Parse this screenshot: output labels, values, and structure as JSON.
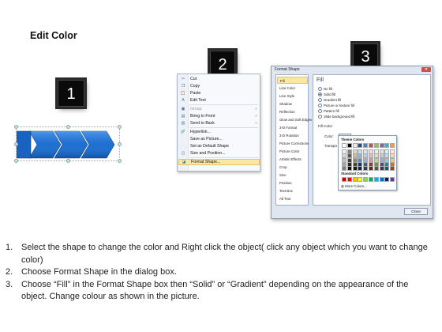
{
  "title": "Edit Color",
  "badges": [
    "1",
    "2",
    "3"
  ],
  "context_menu": {
    "items": [
      {
        "icon": "scissors-icon",
        "glyph": "✂",
        "label": "Cut",
        "disabled": false,
        "submenu": false,
        "highlighted": false
      },
      {
        "icon": "copy-icon",
        "glyph": "❐",
        "label": "Copy",
        "disabled": false,
        "submenu": false,
        "highlighted": false
      },
      {
        "icon": "paste-icon",
        "glyph": "📋",
        "label": "Paste",
        "disabled": false,
        "submenu": false,
        "highlighted": false
      },
      {
        "icon": "edit-text-icon",
        "glyph": "A",
        "label": "Edit Text",
        "disabled": false,
        "submenu": false,
        "highlighted": false
      },
      {
        "icon": "group-icon",
        "glyph": "▣",
        "label": "Group",
        "disabled": true,
        "submenu": true,
        "highlighted": false
      },
      {
        "icon": "bring-front-icon",
        "glyph": "▤",
        "label": "Bring to Front",
        "disabled": false,
        "submenu": true,
        "highlighted": false
      },
      {
        "icon": "send-back-icon",
        "glyph": "▥",
        "label": "Send to Back",
        "disabled": false,
        "submenu": true,
        "highlighted": false
      },
      {
        "icon": "hyperlink-icon",
        "glyph": "🔗",
        "label": "Hyperlink...",
        "disabled": false,
        "submenu": false,
        "highlighted": false
      },
      {
        "icon": "save-picture-icon",
        "glyph": "",
        "label": "Save as Picture...",
        "disabled": false,
        "submenu": false,
        "highlighted": false
      },
      {
        "icon": "",
        "glyph": "",
        "label": "Set as Default Shape",
        "disabled": false,
        "submenu": false,
        "highlighted": false
      },
      {
        "icon": "size-position-icon",
        "glyph": "◫",
        "label": "Size and Position...",
        "disabled": false,
        "submenu": false,
        "highlighted": false
      },
      {
        "icon": "format-shape-icon",
        "glyph": "◪",
        "label": "Format Shape...",
        "disabled": false,
        "submenu": false,
        "highlighted": true
      }
    ]
  },
  "dialog": {
    "title": "Format Shape",
    "close_glyph": "✕",
    "nav": [
      "Fill",
      "Line Color",
      "Line Style",
      "Shadow",
      "Reflection",
      "Glow and Soft Edges",
      "3-D Format",
      "3-D Rotation",
      "Picture Corrections",
      "Picture Color",
      "Artistic Effects",
      "Crop",
      "Size",
      "Position",
      "Text Box",
      "Alt Text"
    ],
    "selected_nav": "Fill",
    "heading": "Fill",
    "options": [
      {
        "label": "No fill",
        "checked": false
      },
      {
        "label": "Solid fill",
        "checked": true
      },
      {
        "label": "Gradient fill",
        "checked": false
      },
      {
        "label": "Picture or texture fill",
        "checked": false
      },
      {
        "label": "Pattern fill",
        "checked": false
      },
      {
        "label": "Slide background fill",
        "checked": false
      }
    ],
    "fill_color_label": "Fill Color",
    "color_label": "Color:",
    "transparency_label": "Transpa",
    "close_button": "Close"
  },
  "color_picker": {
    "theme_label": "Theme Colors",
    "standard_label": "Standard Colors",
    "more_label": "More Colors...",
    "theme_top": [
      "#ffffff",
      "#000000",
      "#eeece1",
      "#1f497d",
      "#4f81bd",
      "#c0504d",
      "#9bbb59",
      "#8064a2",
      "#4bacc6",
      "#f79646"
    ],
    "theme_shades": [
      [
        "#f2f2f2",
        "#7f7f7f",
        "#ddd9c3",
        "#c6d9f0",
        "#dbe5f1",
        "#f2dcdb",
        "#ebf1dd",
        "#e5e0ec",
        "#dbeef3",
        "#fdeada"
      ],
      [
        "#d8d8d8",
        "#595959",
        "#c4bd97",
        "#8db3e2",
        "#b8cce4",
        "#e5b9b7",
        "#d7e3bc",
        "#ccc1d9",
        "#b7dde8",
        "#fbd5b5"
      ],
      [
        "#bfbfbf",
        "#3f3f3f",
        "#938953",
        "#548dd4",
        "#95b3d7",
        "#d99694",
        "#c3d69b",
        "#b2a2c7",
        "#92cddc",
        "#fac08f"
      ],
      [
        "#a5a5a5",
        "#262626",
        "#494429",
        "#17365d",
        "#366092",
        "#953734",
        "#76923c",
        "#5f497a",
        "#31859b",
        "#e36c09"
      ],
      [
        "#7f7f7f",
        "#0c0c0c",
        "#1d1b10",
        "#0f243e",
        "#244061",
        "#632423",
        "#4f6128",
        "#3f3151",
        "#205867",
        "#974806"
      ]
    ],
    "standard": [
      "#c00000",
      "#ff0000",
      "#ffc000",
      "#ffff00",
      "#92d050",
      "#00b050",
      "#00b0f0",
      "#0070c0",
      "#002060",
      "#7030a0"
    ]
  },
  "instructions": [
    {
      "n": "1.",
      "text": "Select the shape to change the color and Right click the object( click any object which you want to change color)"
    },
    {
      "n": "2.",
      "text": "Choose Format Shape in the dialog box."
    },
    {
      "n": "3.",
      "text": "Choose “Fill” in the Format Shape box then “Solid” or “Gradient” depending on the appearance of the object. Change colour as shown in the picture."
    }
  ],
  "colors": {
    "shape_blue": "#1f6fd0",
    "shape_light": "#3d8fe8",
    "highlight": "#fbe6a6"
  }
}
